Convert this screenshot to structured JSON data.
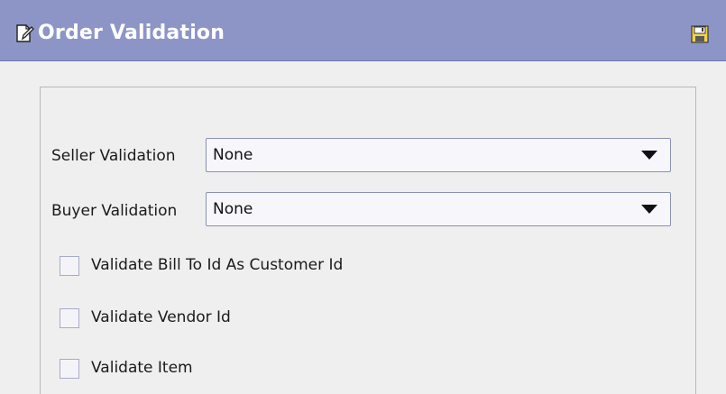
{
  "header": {
    "title": "Order Validation",
    "title_icon": "edit-document-icon",
    "save_icon": "save-disk-icon",
    "background_color": "#8c95c6"
  },
  "fields": {
    "seller_validation": {
      "label": "Seller Validation",
      "value": "None"
    },
    "buyer_validation": {
      "label": "Buyer Validation",
      "value": "None"
    }
  },
  "checkboxes": [
    {
      "label": "Validate Bill To Id As Customer Id",
      "checked": false
    },
    {
      "label": "Validate Vendor Id",
      "checked": false
    },
    {
      "label": "Validate Item",
      "checked": false
    }
  ]
}
